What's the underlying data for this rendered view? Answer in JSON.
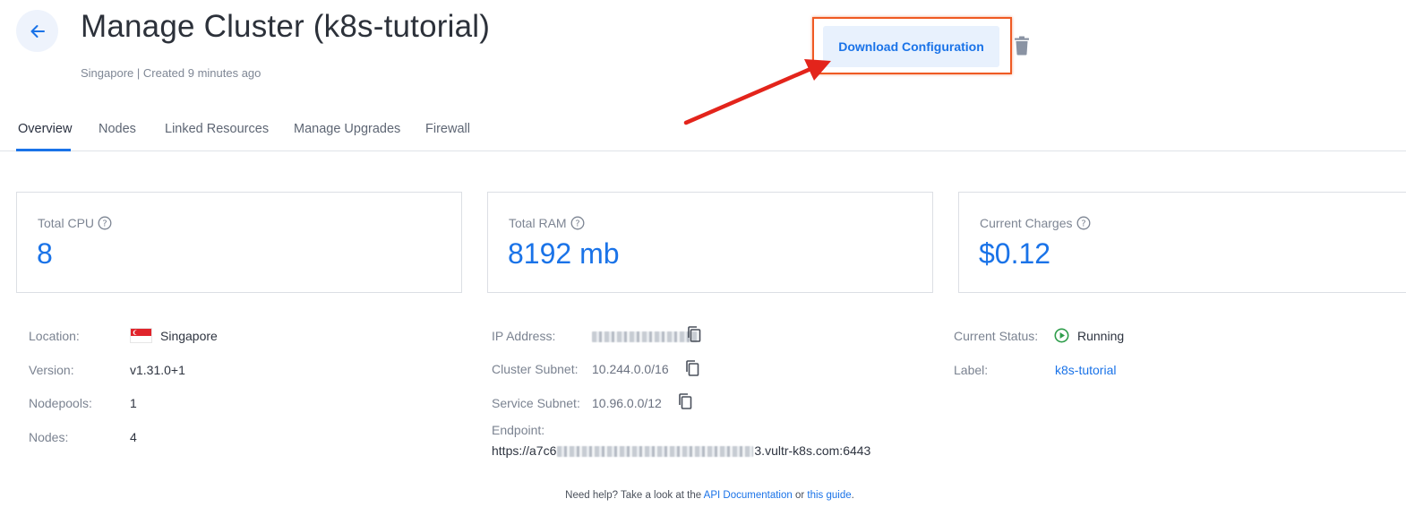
{
  "header": {
    "title": "Manage Cluster (k8s-tutorial)",
    "subtitle": "Singapore | Created 9 minutes ago",
    "download_label": "Download Configuration"
  },
  "tabs": [
    {
      "label": "Overview",
      "active": true
    },
    {
      "label": "Nodes"
    },
    {
      "label": "Linked Resources"
    },
    {
      "label": "Manage Upgrades"
    },
    {
      "label": "Firewall"
    }
  ],
  "stats": [
    {
      "label": "Total CPU",
      "value": "8"
    },
    {
      "label": "Total RAM",
      "value": "8192 mb"
    },
    {
      "label": "Current Charges",
      "value": "$0.12"
    }
  ],
  "details_left": [
    {
      "label": "Location:",
      "value": "Singapore"
    },
    {
      "label": "Version:",
      "value": "v1.31.0+1"
    },
    {
      "label": "Nodepools:",
      "value": "1"
    },
    {
      "label": "Nodes:",
      "value": "4"
    }
  ],
  "details_mid": {
    "ip_label": "IP Address:",
    "cluster_subnet_label": "Cluster Subnet:",
    "cluster_subnet_value": "10.244.0.0/16",
    "service_subnet_label": "Service Subnet:",
    "service_subnet_value": "10.96.0.0/12",
    "endpoint_label": "Endpoint:",
    "endpoint_prefix": "https://a7c6",
    "endpoint_suffix": "3.vultr-k8s.com:6443"
  },
  "details_right": {
    "status_label": "Current Status:",
    "status_value": "Running",
    "label_label": "Label:",
    "label_value": "k8s-tutorial"
  },
  "help": {
    "text1": "Need help? Take a look at the ",
    "link1": "API Documentation",
    "text2": " or ",
    "link2": "this guide",
    "text3": "."
  },
  "colors": {
    "accent": "#1a73e8",
    "highlight": "#ef5a23",
    "arrow": "#e3241b",
    "running": "#2e9d4a"
  },
  "icons": [
    "arrow-left-icon",
    "trash-icon",
    "help-circle-icon",
    "copy-icon",
    "singapore-flag-icon",
    "play-circle-icon"
  ]
}
